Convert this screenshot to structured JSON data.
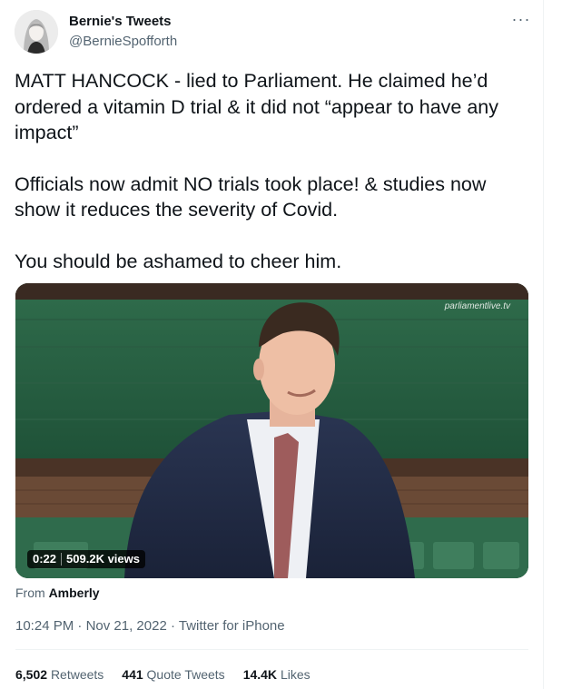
{
  "author": {
    "display_name": "Bernie's Tweets",
    "handle": "@BernieSpofforth"
  },
  "tweet": {
    "paragraphs": [
      "MATT HANCOCK - lied to Parliament. He claimed he’d ordered a vitamin D trial & it did not “appear to have any impact”",
      "Officials now admit NO trials took place! & studies now show it reduces the severity of Covid.",
      "You should be ashamed to cheer him."
    ]
  },
  "media": {
    "watermark": "parliamentlive.tv",
    "duration": "0:22",
    "views": "509.2K views"
  },
  "source": {
    "prefix": "From",
    "name": "Amberly"
  },
  "meta": {
    "time": "10:24 PM",
    "separator": "·",
    "date": "Nov 21, 2022",
    "client": "Twitter for iPhone"
  },
  "stats": {
    "retweets_count": "6,502",
    "retweets_label": "Retweets",
    "quotes_count": "441",
    "quotes_label": "Quote Tweets",
    "likes_count": "14.4K",
    "likes_label": "Likes"
  },
  "icons": {
    "more": "more-horizontal-icon"
  }
}
